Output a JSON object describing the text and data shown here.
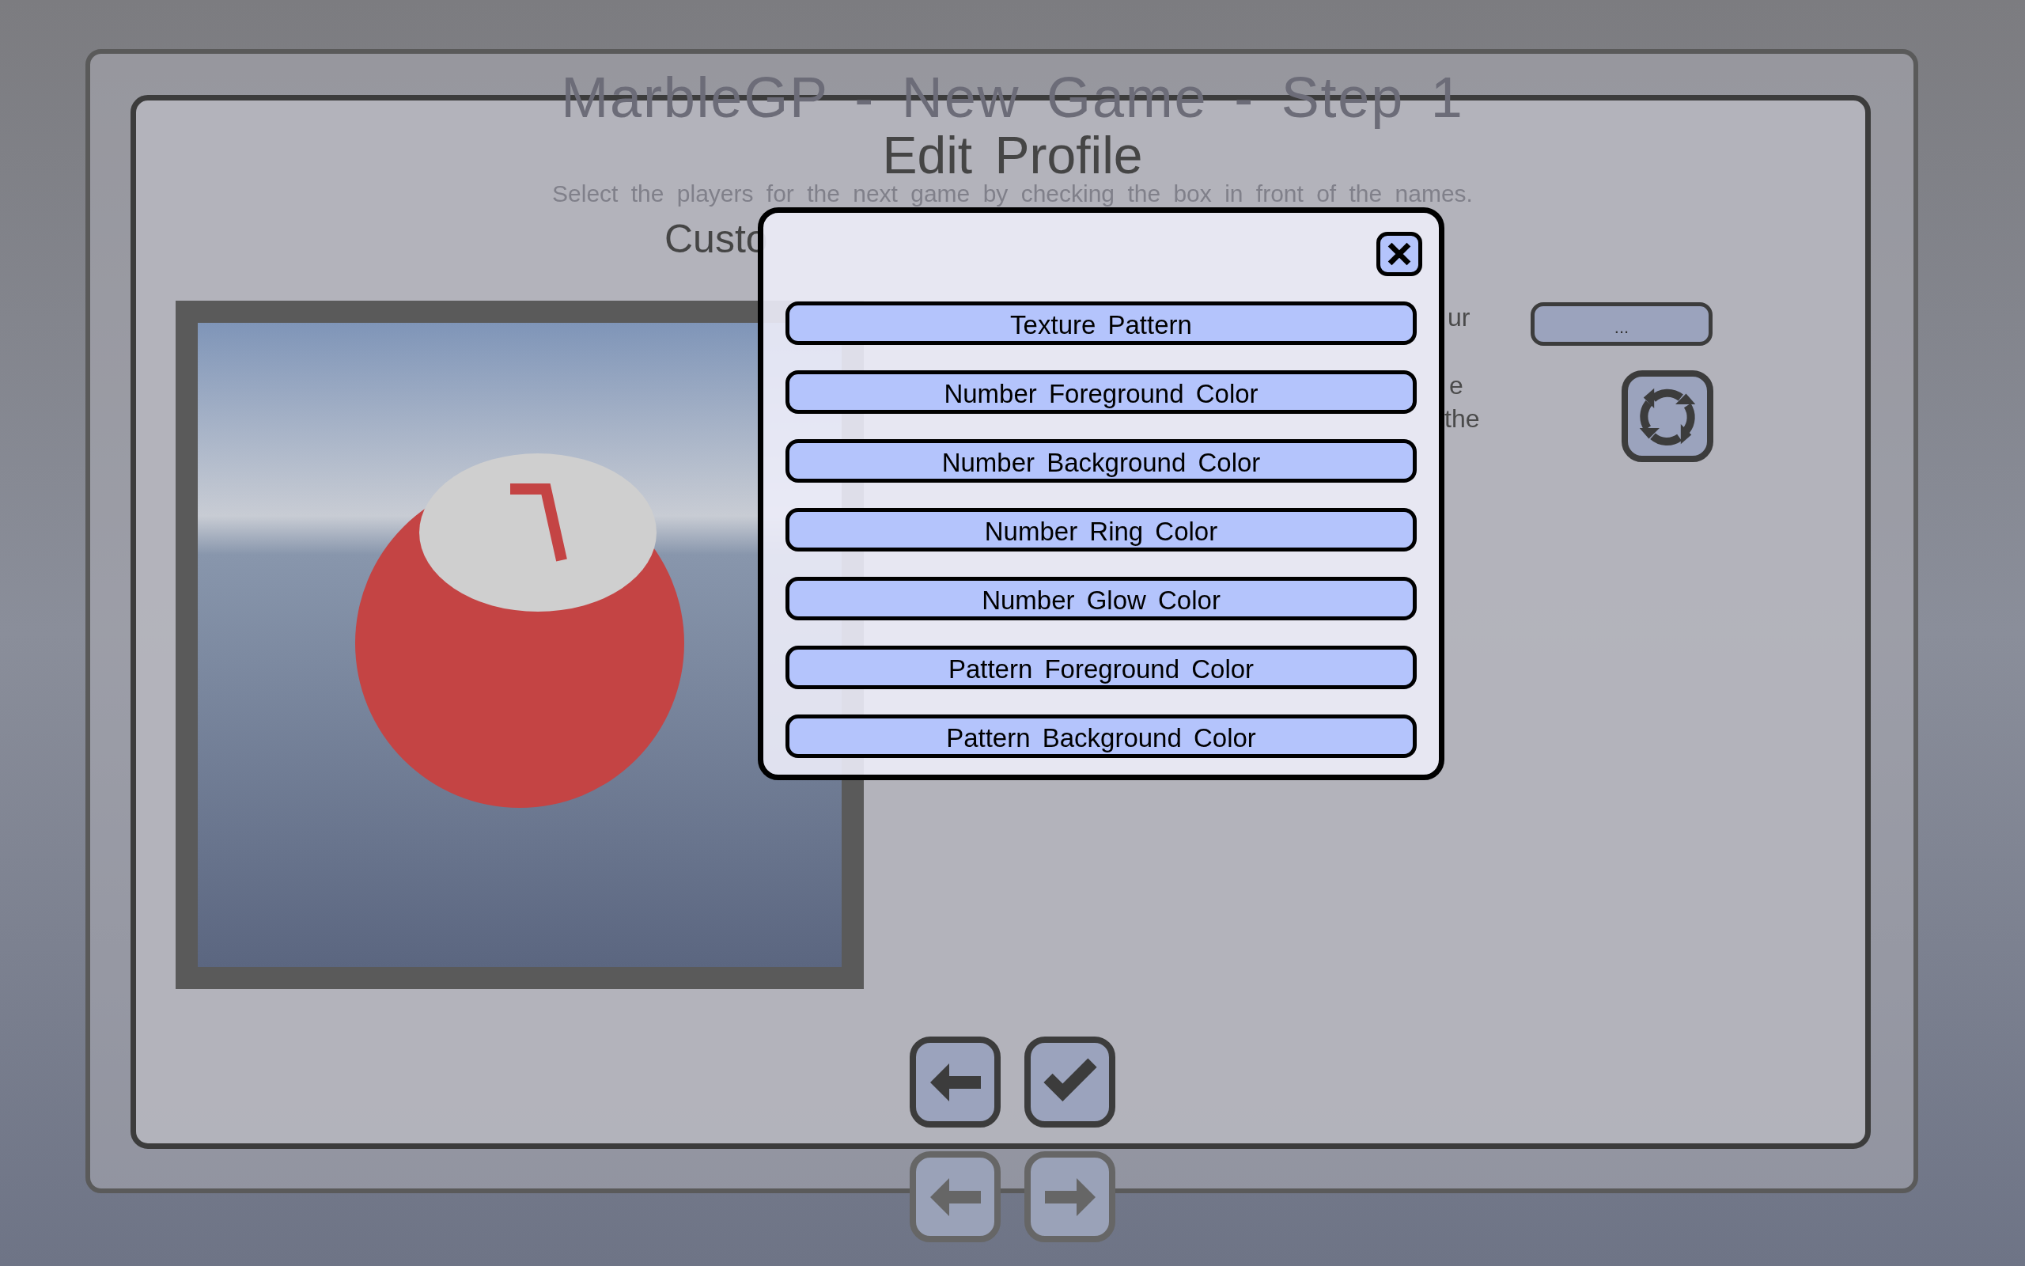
{
  "background_screen": {
    "title": "MarbleGP - New Game - Step 1",
    "subtitle": "Select the players for the next game by checking the box in front of the names."
  },
  "dialog": {
    "title": "Edit Profile",
    "heading": "Custo",
    "description_fragments": [
      "ur",
      "e",
      "the"
    ],
    "preset_button": "..."
  },
  "popup": {
    "items": [
      {
        "label": "Texture Pattern"
      },
      {
        "label": "Number Foreground Color"
      },
      {
        "label": "Number Background Color"
      },
      {
        "label": "Number Ring Color"
      },
      {
        "label": "Number Glow Color"
      },
      {
        "label": "Pattern Foreground Color"
      },
      {
        "label": "Pattern Background Color"
      }
    ]
  }
}
